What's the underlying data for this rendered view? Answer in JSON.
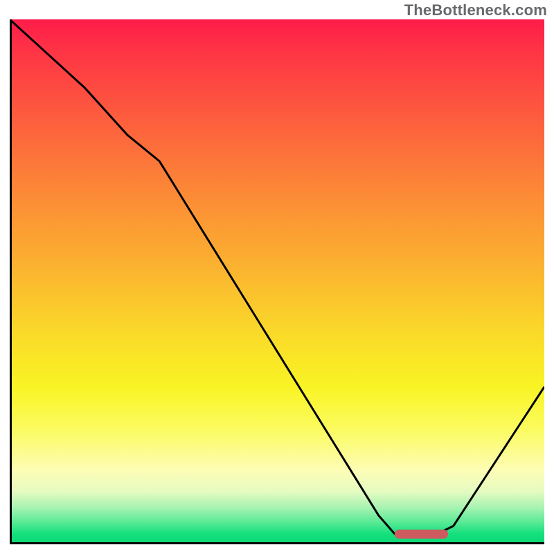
{
  "watermark": "TheBottleneck.com",
  "chart_data": {
    "type": "line",
    "title": "",
    "xlabel": "",
    "ylabel": "",
    "xlim": [
      0,
      100
    ],
    "ylim": [
      0,
      100
    ],
    "series": [
      {
        "name": "bottleneck-curve",
        "x": [
          0,
          14,
          22,
          28,
          69,
          72,
          80,
          83,
          100
        ],
        "values": [
          100,
          87,
          78,
          73,
          5.5,
          2,
          2,
          3.5,
          30
        ]
      }
    ],
    "marker": {
      "name": "optimal-zone",
      "shape": "rounded-bar",
      "color": "#cd5a5f",
      "x_start": 72,
      "x_end": 82,
      "y": 2
    },
    "background_gradient": {
      "stops": [
        {
          "pos": 0.0,
          "color": "#fe1c4a"
        },
        {
          "pos": 0.32,
          "color": "#fc8637"
        },
        {
          "pos": 0.6,
          "color": "#fada29"
        },
        {
          "pos": 0.86,
          "color": "#fdfdb6"
        },
        {
          "pos": 1.0,
          "color": "#0bd873"
        }
      ]
    }
  }
}
